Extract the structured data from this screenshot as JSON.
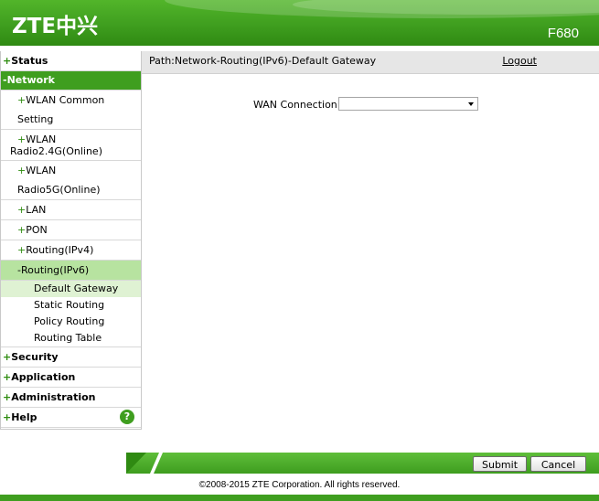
{
  "header": {
    "logo": "ZTE中兴",
    "model": "F680"
  },
  "sidebar": {
    "items": [
      {
        "prefix": "+",
        "label": "Status"
      },
      {
        "prefix": "-",
        "label": "Network"
      },
      {
        "prefix": "+",
        "label": "WLAN Common Setting"
      },
      {
        "prefix": "+",
        "label": "WLAN",
        "label2": "Radio2.4G(Online)"
      },
      {
        "prefix": "+",
        "label": "WLAN Radio5G(Online)"
      },
      {
        "prefix": "+",
        "label": "LAN"
      },
      {
        "prefix": "+",
        "label": "PON"
      },
      {
        "prefix": "+",
        "label": "Routing(IPv4)"
      },
      {
        "prefix": "-",
        "label": "Routing(IPv6)"
      },
      {
        "label": "Default Gateway"
      },
      {
        "label": "Static Routing"
      },
      {
        "label": "Policy Routing"
      },
      {
        "label": "Routing Table"
      },
      {
        "prefix": "+",
        "label": "Security"
      },
      {
        "prefix": "+",
        "label": "Application"
      },
      {
        "prefix": "+",
        "label": "Administration"
      },
      {
        "prefix": "+",
        "label": "Help"
      }
    ],
    "help_glyph": "?"
  },
  "main": {
    "path": "Path:Network-Routing(IPv6)-Default Gateway",
    "logout": "Logout",
    "wan_label": "WAN Connection",
    "wan_value": ""
  },
  "footer": {
    "submit": "Submit",
    "cancel": "Cancel",
    "copyright": "©2008-2015 ZTE Corporation. All rights reserved."
  },
  "colors": {
    "brand_green": "#3f9e1f",
    "sub_active": "#b7e3a0",
    "leaf_current": "#dff2d3"
  }
}
